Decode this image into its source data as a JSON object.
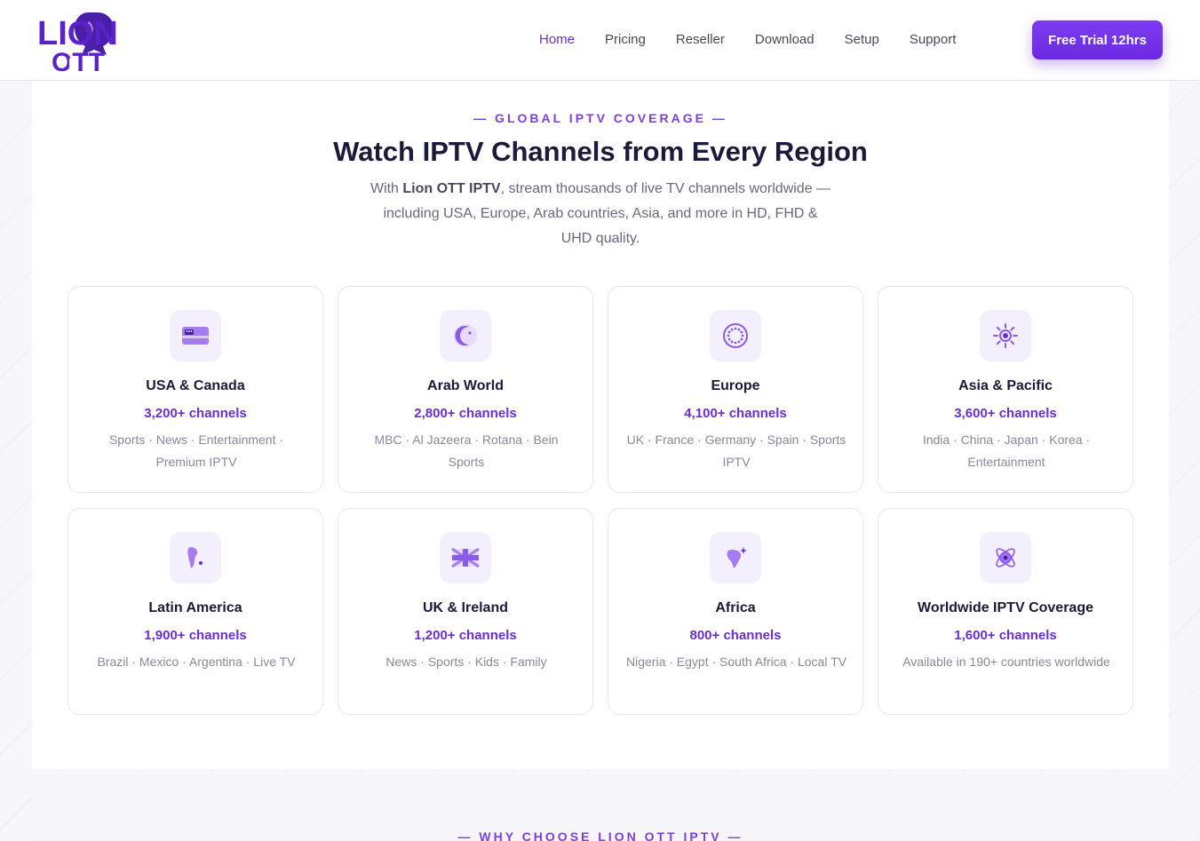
{
  "brand": {
    "logo_top": "LION",
    "logo_bottom": "OTT",
    "accent": "#6b2fd0"
  },
  "nav": {
    "items": [
      {
        "label": "Home",
        "active": true
      },
      {
        "label": "Pricing",
        "active": false
      },
      {
        "label": "Reseller",
        "active": false
      },
      {
        "label": "Download",
        "active": false
      },
      {
        "label": "Setup",
        "active": false
      },
      {
        "label": "Support",
        "active": false
      }
    ],
    "cta_label": "Free Trial 12hrs"
  },
  "coverage": {
    "eyebrow": "— GLOBAL IPTV COVERAGE —",
    "title": "Watch IPTV Channels from Every Region",
    "subtitle_prefix": "With ",
    "subtitle_brand": "Lion OTT IPTV",
    "subtitle_rest": ", stream thousands of live TV channels worldwide — including USA, Europe, Arab countries, Asia, and more in HD, FHD & UHD quality.",
    "regions": [
      {
        "icon": "card-icon",
        "title": "USA & Canada",
        "count": "3,200+ channels",
        "desc": "Sports · News · Entertainment · Premium IPTV"
      },
      {
        "icon": "crescent-icon",
        "title": "Arab World",
        "count": "2,800+ channels",
        "desc": "MBC · Al Jazeera · Rotana · Bein Sports"
      },
      {
        "icon": "eu-stars-icon",
        "title": "Europe",
        "count": "4,100+ channels",
        "desc": "UK · France · Germany · Spain · Sports IPTV"
      },
      {
        "icon": "sun-icon",
        "title": "Asia & Pacific",
        "count": "3,600+ channels",
        "desc": "India · China · Japan · Korea · Entertainment"
      },
      {
        "icon": "south-america-icon",
        "title": "Latin America",
        "count": "1,900+ channels",
        "desc": "Brazil · Mexico · Argentina · Live TV"
      },
      {
        "icon": "union-jack-icon",
        "title": "UK & Ireland",
        "count": "1,200+ channels",
        "desc": "News · Sports · Kids · Family"
      },
      {
        "icon": "africa-icon",
        "title": "Africa",
        "count": "800+ channels",
        "desc": "Nigeria · Egypt · South Africa · Local TV"
      },
      {
        "icon": "globe-orbit-icon",
        "title": "Worldwide IPTV Coverage",
        "count": "1,600+ channels",
        "desc": "Available in 190+ countries worldwide"
      }
    ]
  },
  "next_section": {
    "eyebrow": "— WHY CHOOSE LION OTT IPTV —"
  }
}
